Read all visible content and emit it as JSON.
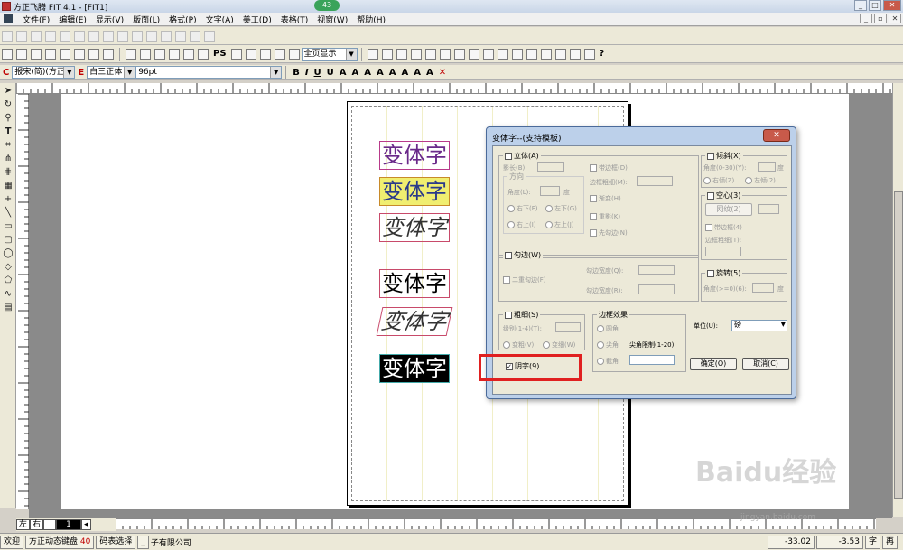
{
  "window": {
    "title": "方正飞腾 FIT 4.1 - [FIT1]",
    "badge": "43"
  },
  "menu": [
    "文件(F)",
    "编辑(E)",
    "显示(V)",
    "版面(L)",
    "格式(P)",
    "文字(A)",
    "美工(D)",
    "表格(T)",
    "视窗(W)",
    "帮助(H)"
  ],
  "toolbar": {
    "zoom": "全页显示",
    "font_prefix": "C",
    "font_cn": "报宋(简)(方正)",
    "font_en_prefix": "E",
    "font_en": "白三正体",
    "font_size": "96pt"
  },
  "canvas": {
    "samples": [
      "变体字",
      "变体字",
      "变体字",
      "变体字",
      "变体字",
      "变体字"
    ]
  },
  "dialog": {
    "title": "变体字--(支持模板)",
    "close": "✕",
    "stereo": {
      "title": "立体(A)",
      "shadow": "影长(B):",
      "direction": "方向",
      "angle": "角度(L):",
      "angle_unit": "度",
      "dir_rb": "右下(F)",
      "dir_lb": "左下(G)",
      "dir_ru": "右上(I)",
      "dir_lu": "左上(J)",
      "with_border": "带边框(D)",
      "border_weight": "边框粗细(M):",
      "gradient": "渐变(H)",
      "overlap": "重影(K)",
      "hook_first": "先勾边(N)"
    },
    "skew": {
      "title": "倾斜(X)",
      "angle": "角度(0-30)(Y):",
      "unit": "度",
      "right": "右倾(Z)",
      "left": "左倾(2)"
    },
    "hollow": {
      "title": "空心(3)",
      "pattern_btn": "网纹(2)",
      "with_border": "带边框(4)",
      "border_weight": "边框粗细(T):"
    },
    "outline": {
      "title": "勾边(W)",
      "double": "二重勾边(F)",
      "width1": "勾边宽度(Q):",
      "width2": "勾边宽度(R):"
    },
    "rotate": {
      "title": "旋转(5)",
      "angle": "角度(>=0)(6):",
      "unit": "度"
    },
    "thickness": {
      "title": "粗细(S)",
      "level": "级别(1-4)(T):",
      "thick": "变粗(V)",
      "thin": "变细(W)"
    },
    "border_effect": {
      "title": "边框效果",
      "round": "圆角",
      "sharp": "尖角",
      "sharp_limit": "尖角限制(1-20)",
      "bevel": "截角"
    },
    "unit_label": "单位(U):",
    "unit_value": "磅",
    "reverse": "阴字(9)",
    "ok": "确定(O)",
    "cancel": "取消(C)"
  },
  "pagebar": {
    "left": "左",
    "right": "右",
    "page": "1"
  },
  "status": {
    "prefix": "欢迎",
    "ime_name": "方正动态键盘",
    "ime_num": "40",
    "code_table": "码表选择",
    "dash": "_",
    "company": "子有限公司",
    "x": "-33.02",
    "y": "-3.53",
    "mode": "字",
    "mode2": "再"
  },
  "watermark": {
    "brand": "Baidu经验",
    "url": "jingyan.baidu.com"
  },
  "colors": {
    "highlight": "#e02020",
    "dialog_frame": "#bcd0ea"
  }
}
